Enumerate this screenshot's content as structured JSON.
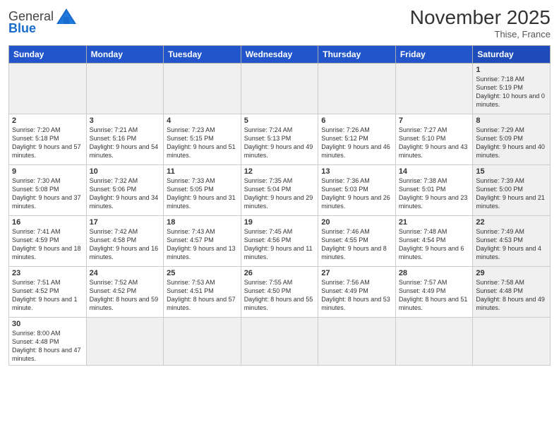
{
  "header": {
    "logo_general": "General",
    "logo_blue": "Blue",
    "month_title": "November 2025",
    "subtitle": "Thise, France"
  },
  "weekdays": [
    "Sunday",
    "Monday",
    "Tuesday",
    "Wednesday",
    "Thursday",
    "Friday",
    "Saturday"
  ],
  "weeks": [
    [
      {
        "day": "",
        "info": ""
      },
      {
        "day": "",
        "info": ""
      },
      {
        "day": "",
        "info": ""
      },
      {
        "day": "",
        "info": ""
      },
      {
        "day": "",
        "info": ""
      },
      {
        "day": "",
        "info": ""
      },
      {
        "day": "1",
        "info": "Sunrise: 7:18 AM\nSunset: 5:19 PM\nDaylight: 10 hours and 0 minutes."
      }
    ],
    [
      {
        "day": "2",
        "info": "Sunrise: 7:20 AM\nSunset: 5:18 PM\nDaylight: 9 hours and 57 minutes."
      },
      {
        "day": "3",
        "info": "Sunrise: 7:21 AM\nSunset: 5:16 PM\nDaylight: 9 hours and 54 minutes."
      },
      {
        "day": "4",
        "info": "Sunrise: 7:23 AM\nSunset: 5:15 PM\nDaylight: 9 hours and 51 minutes."
      },
      {
        "day": "5",
        "info": "Sunrise: 7:24 AM\nSunset: 5:13 PM\nDaylight: 9 hours and 49 minutes."
      },
      {
        "day": "6",
        "info": "Sunrise: 7:26 AM\nSunset: 5:12 PM\nDaylight: 9 hours and 46 minutes."
      },
      {
        "day": "7",
        "info": "Sunrise: 7:27 AM\nSunset: 5:10 PM\nDaylight: 9 hours and 43 minutes."
      },
      {
        "day": "8",
        "info": "Sunrise: 7:29 AM\nSunset: 5:09 PM\nDaylight: 9 hours and 40 minutes."
      }
    ],
    [
      {
        "day": "9",
        "info": "Sunrise: 7:30 AM\nSunset: 5:08 PM\nDaylight: 9 hours and 37 minutes."
      },
      {
        "day": "10",
        "info": "Sunrise: 7:32 AM\nSunset: 5:06 PM\nDaylight: 9 hours and 34 minutes."
      },
      {
        "day": "11",
        "info": "Sunrise: 7:33 AM\nSunset: 5:05 PM\nDaylight: 9 hours and 31 minutes."
      },
      {
        "day": "12",
        "info": "Sunrise: 7:35 AM\nSunset: 5:04 PM\nDaylight: 9 hours and 29 minutes."
      },
      {
        "day": "13",
        "info": "Sunrise: 7:36 AM\nSunset: 5:03 PM\nDaylight: 9 hours and 26 minutes."
      },
      {
        "day": "14",
        "info": "Sunrise: 7:38 AM\nSunset: 5:01 PM\nDaylight: 9 hours and 23 minutes."
      },
      {
        "day": "15",
        "info": "Sunrise: 7:39 AM\nSunset: 5:00 PM\nDaylight: 9 hours and 21 minutes."
      }
    ],
    [
      {
        "day": "16",
        "info": "Sunrise: 7:41 AM\nSunset: 4:59 PM\nDaylight: 9 hours and 18 minutes."
      },
      {
        "day": "17",
        "info": "Sunrise: 7:42 AM\nSunset: 4:58 PM\nDaylight: 9 hours and 16 minutes."
      },
      {
        "day": "18",
        "info": "Sunrise: 7:43 AM\nSunset: 4:57 PM\nDaylight: 9 hours and 13 minutes."
      },
      {
        "day": "19",
        "info": "Sunrise: 7:45 AM\nSunset: 4:56 PM\nDaylight: 9 hours and 11 minutes."
      },
      {
        "day": "20",
        "info": "Sunrise: 7:46 AM\nSunset: 4:55 PM\nDaylight: 9 hours and 8 minutes."
      },
      {
        "day": "21",
        "info": "Sunrise: 7:48 AM\nSunset: 4:54 PM\nDaylight: 9 hours and 6 minutes."
      },
      {
        "day": "22",
        "info": "Sunrise: 7:49 AM\nSunset: 4:53 PM\nDaylight: 9 hours and 4 minutes."
      }
    ],
    [
      {
        "day": "23",
        "info": "Sunrise: 7:51 AM\nSunset: 4:52 PM\nDaylight: 9 hours and 1 minute."
      },
      {
        "day": "24",
        "info": "Sunrise: 7:52 AM\nSunset: 4:52 PM\nDaylight: 8 hours and 59 minutes."
      },
      {
        "day": "25",
        "info": "Sunrise: 7:53 AM\nSunset: 4:51 PM\nDaylight: 8 hours and 57 minutes."
      },
      {
        "day": "26",
        "info": "Sunrise: 7:55 AM\nSunset: 4:50 PM\nDaylight: 8 hours and 55 minutes."
      },
      {
        "day": "27",
        "info": "Sunrise: 7:56 AM\nSunset: 4:49 PM\nDaylight: 8 hours and 53 minutes."
      },
      {
        "day": "28",
        "info": "Sunrise: 7:57 AM\nSunset: 4:49 PM\nDaylight: 8 hours and 51 minutes."
      },
      {
        "day": "29",
        "info": "Sunrise: 7:58 AM\nSunset: 4:48 PM\nDaylight: 8 hours and 49 minutes."
      }
    ],
    [
      {
        "day": "30",
        "info": "Sunrise: 8:00 AM\nSunset: 4:48 PM\nDaylight: 8 hours and 47 minutes."
      },
      {
        "day": "",
        "info": ""
      },
      {
        "day": "",
        "info": ""
      },
      {
        "day": "",
        "info": ""
      },
      {
        "day": "",
        "info": ""
      },
      {
        "day": "",
        "info": ""
      },
      {
        "day": "",
        "info": ""
      }
    ]
  ]
}
